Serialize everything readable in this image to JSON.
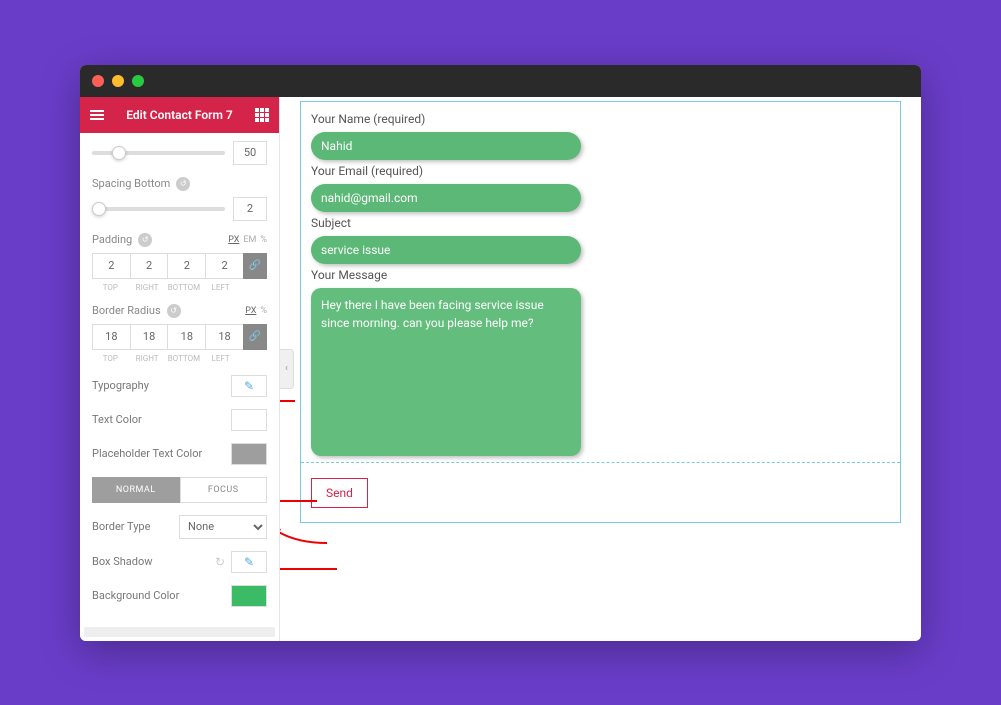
{
  "header": {
    "title": "Edit Contact Form 7"
  },
  "sliders": {
    "top_value": "50",
    "spacing_bottom_label": "Spacing Bottom",
    "spacing_bottom_value": "2"
  },
  "padding": {
    "label": "Padding",
    "units": [
      "PX",
      "EM",
      "%"
    ],
    "values": [
      "2",
      "2",
      "2",
      "2"
    ],
    "sub": [
      "TOP",
      "RIGHT",
      "BOTTOM",
      "LEFT"
    ]
  },
  "radius": {
    "label": "Border Radius",
    "units": [
      "PX",
      "%"
    ],
    "values": [
      "18",
      "18",
      "18",
      "18"
    ],
    "sub": [
      "TOP",
      "RIGHT",
      "BOTTOM",
      "LEFT"
    ]
  },
  "typography_label": "Typography",
  "text_color_label": "Text Color",
  "placeholder_label": "Placeholder Text Color",
  "tabs": {
    "normal": "NORMAL",
    "focus": "FOCUS"
  },
  "border_type": {
    "label": "Border Type",
    "value": "None"
  },
  "box_shadow_label": "Box Shadow",
  "bg_color_label": "Background Color",
  "form": {
    "name_label": "Your Name (required)",
    "name_value": "Nahid",
    "email_label": "Your Email (required)",
    "email_value": "nahid@gmail.com",
    "subject_label": "Subject",
    "subject_value": "service issue",
    "message_label": "Your Message",
    "message_value": "Hey there I have been facing service issue since morning. can you please help me?",
    "send": "Send"
  }
}
